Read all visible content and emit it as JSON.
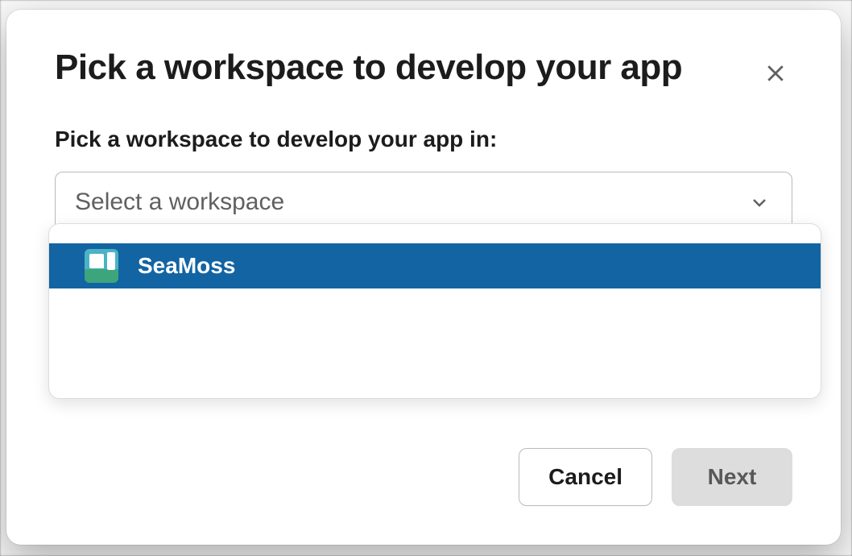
{
  "modal": {
    "title": "Pick a workspace to develop your app",
    "field_label": "Pick a workspace to develop your app in:",
    "select_placeholder": "Select a workspace",
    "options": [
      {
        "name": "SeaMoss"
      }
    ],
    "buttons": {
      "cancel": "Cancel",
      "next": "Next"
    }
  }
}
